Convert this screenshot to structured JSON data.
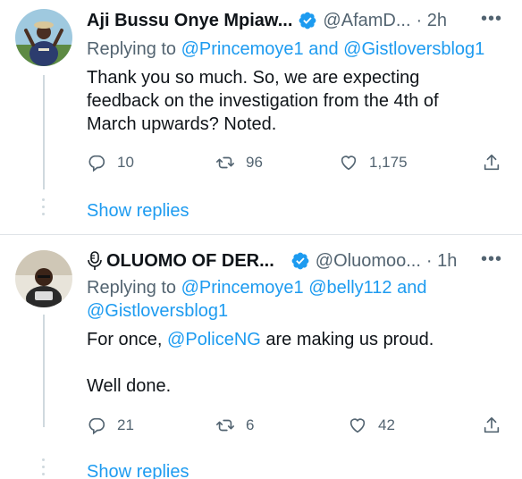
{
  "colors": {
    "link": "#1d9bf0",
    "muted": "#536471",
    "text": "#0f1419",
    "verified": "#1d9bf0"
  },
  "tweets": [
    {
      "name": "Aji Bussu Onye Mpiaw...",
      "handle": "@AfamD...",
      "time": "· 2h",
      "replying_prefix": "Replying to",
      "replying_to": [
        "@Princemoye1",
        "and",
        "@Gistloversblog1"
      ],
      "body_lines": [
        "Thank you so much. So, we are expecting",
        "feedback on the investigation from the 4th of",
        "March upwards? Noted."
      ],
      "replies": "10",
      "retweets": "96",
      "likes": "1,175",
      "show_replies": "Show replies"
    },
    {
      "name": "OLUOMO OF DER...",
      "name_icon": "microphone-icon",
      "handle": "@Oluomoo...",
      "time": "· 1h",
      "replying_prefix": "Replying to",
      "replying_to": [
        "@Princemoye1",
        "@belly112",
        "and",
        "@Gistloversblog1"
      ],
      "body_prefix": "For once,",
      "body_mention": "@PoliceNG",
      "body_suffix": "are making us proud.",
      "body_line2": "Well done.",
      "replies": "21",
      "retweets": "6",
      "likes": "42",
      "show_replies": "Show replies"
    }
  ],
  "more_label": "•••"
}
